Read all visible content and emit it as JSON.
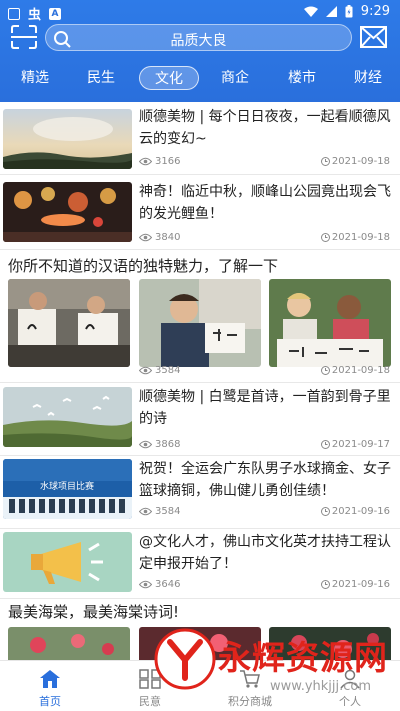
{
  "status_bar": {
    "time": "9:29"
  },
  "header": {
    "search_placeholder": "品质大良"
  },
  "tabs": [
    {
      "label": "精选",
      "active": false
    },
    {
      "label": "民生",
      "active": false
    },
    {
      "label": "文化",
      "active": true
    },
    {
      "label": "商企",
      "active": false
    },
    {
      "label": "楼市",
      "active": false
    },
    {
      "label": "财经",
      "active": false
    }
  ],
  "articles": [
    {
      "title": "顺德美物 | 每个日日夜夜，一起看顺德风云的变幻~",
      "views": "3166",
      "date": "2021-09-18"
    },
    {
      "title": "神奇！临近中秋，顺峰山公园竟出现会飞的发光鲤鱼！",
      "views": "3840",
      "date": "2021-09-18"
    }
  ],
  "gallery_1": {
    "title": "你所不知道的汉语的独特魅力，了解一下",
    "views": "3584",
    "date": "2021-09-18"
  },
  "articles_2": [
    {
      "title": "顺德美物 | 白鹭是首诗，一首韵到骨子里的诗",
      "views": "3868",
      "date": "2021-09-17"
    },
    {
      "title": "祝贺！全运会广东队男子水球摘金、女子篮球摘铜，佛山健儿勇创佳绩！",
      "views": "3584",
      "date": "2021-09-16"
    },
    {
      "title": "@文化人才，佛山市文化英才扶持工程认定申报开始了！",
      "views": "3646",
      "date": "2021-09-16"
    }
  ],
  "thumb_caption": "水球项目比赛",
  "gallery_2": {
    "title": "最美海棠，最美海棠诗词!"
  },
  "bottom_nav": [
    {
      "label": "首页",
      "active": true
    },
    {
      "label": "民意",
      "active": false
    },
    {
      "label": "积分商城",
      "active": false
    },
    {
      "label": "个人",
      "active": false
    }
  ],
  "watermark": {
    "main": "永辉资源网",
    "url": "www.yhkjjj.com"
  },
  "colors": {
    "primary": "#2a6fdc",
    "watermark_red": "#e0241b"
  }
}
